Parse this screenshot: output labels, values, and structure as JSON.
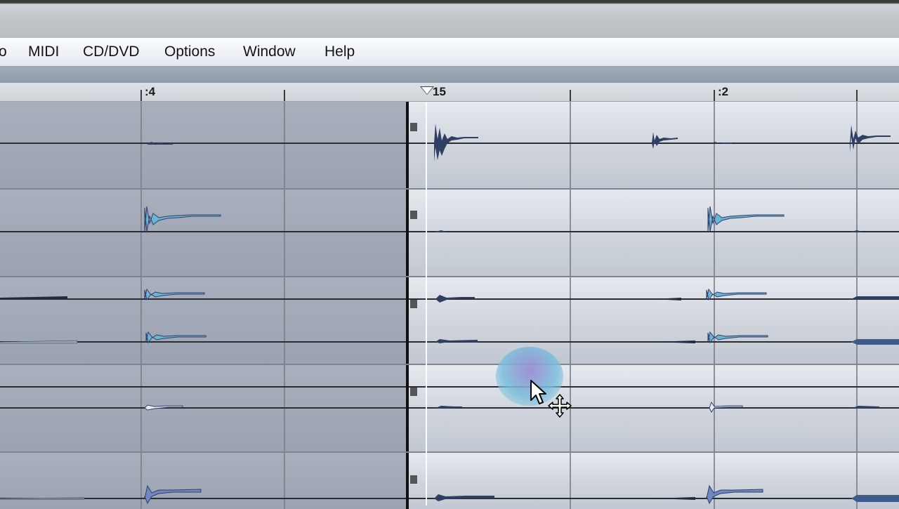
{
  "menu": {
    "partial_item": "o",
    "items": [
      "MIDI",
      "CD/DVD",
      "Options",
      "Window",
      "Help"
    ]
  },
  "ruler": {
    "labels": [
      ":4",
      "15",
      ":2"
    ]
  },
  "colors": {
    "selected_region": "#a3a9b7",
    "region": "#d8dce3",
    "waveform_fill": "#6bb4d8",
    "waveform_dark": "#2f3e63"
  },
  "icons": {
    "cursor": "arrow-pointer-icon",
    "move": "move-cross-icon"
  }
}
